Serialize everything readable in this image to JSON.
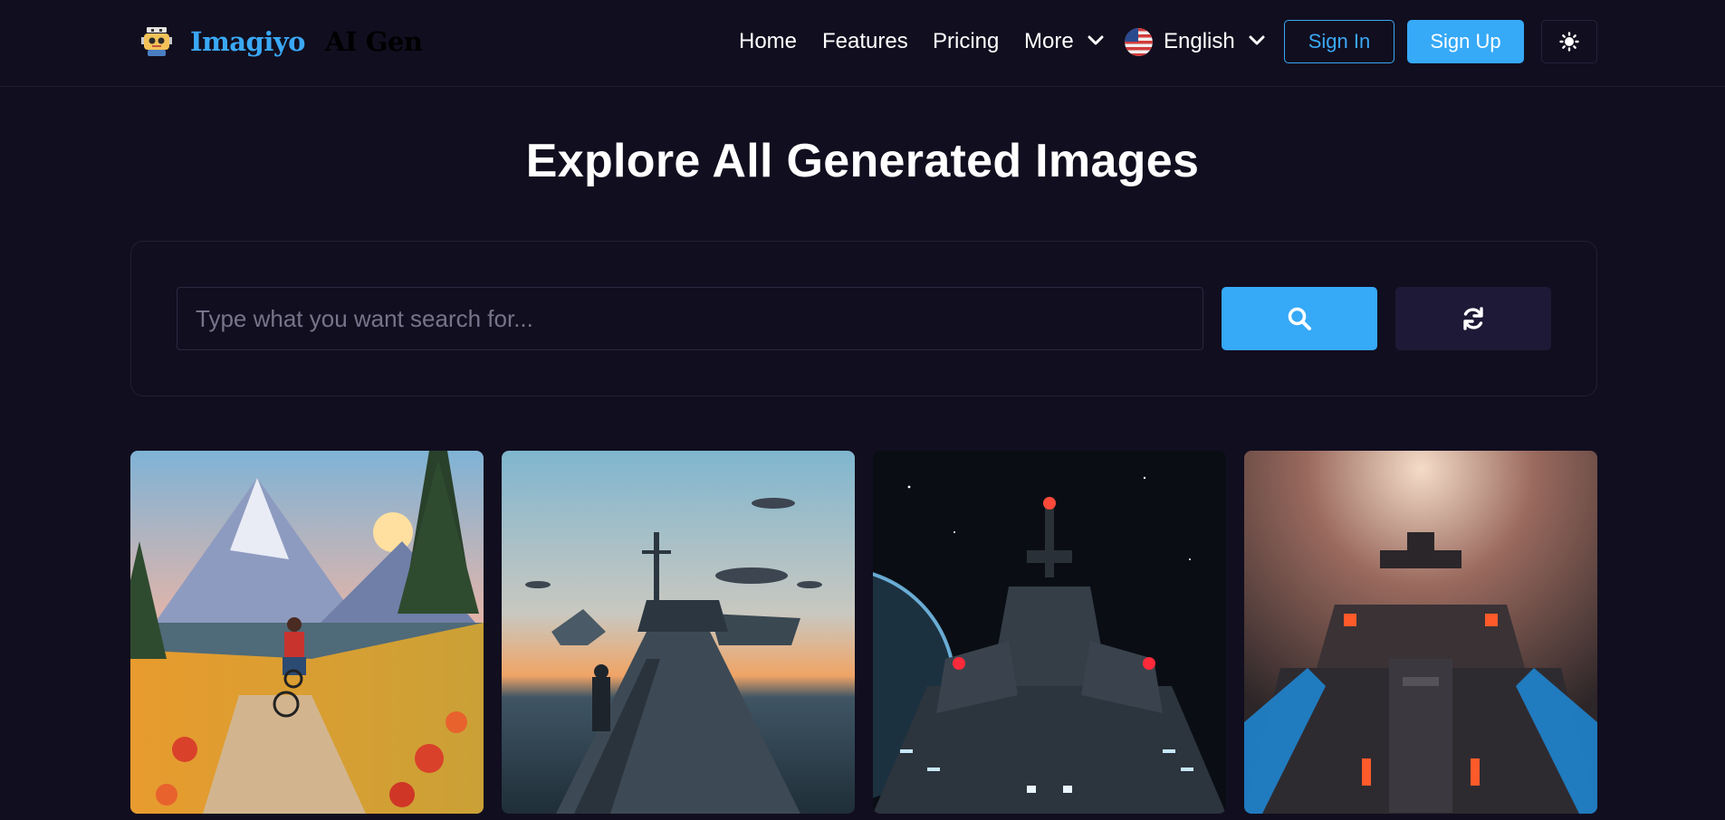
{
  "header": {
    "logo_name": "Imagiyo",
    "logo_sub": "AI Gen",
    "nav": [
      {
        "label": "Home",
        "icon": "none"
      },
      {
        "label": "Features",
        "icon": "none"
      },
      {
        "label": "Pricing",
        "icon": "none"
      },
      {
        "label": "More",
        "icon": "chevron-down-icon"
      },
      {
        "label": "English",
        "icon": "chevron-down-icon"
      }
    ],
    "language_flag": "us-flag-icon",
    "sign_in_label": "Sign In",
    "sign_up_label": "Sign Up",
    "theme_icon": "sun-icon"
  },
  "main": {
    "title": "Explore All Generated Images",
    "search": {
      "placeholder": "Type what you want search for...",
      "value": "",
      "search_icon": "search-icon",
      "refresh_icon": "refresh-icon"
    },
    "gallery": [
      {
        "subject": "cyclist on mountain trail"
      },
      {
        "subject": "warship at sea with aircraft"
      },
      {
        "subject": "spaceship in space"
      },
      {
        "subject": "battleship with neon lights"
      }
    ]
  },
  "colors": {
    "background": "#110e1f",
    "accent": "#36a9f7",
    "refresh_button": "#1e1936",
    "border": "#231f36"
  }
}
